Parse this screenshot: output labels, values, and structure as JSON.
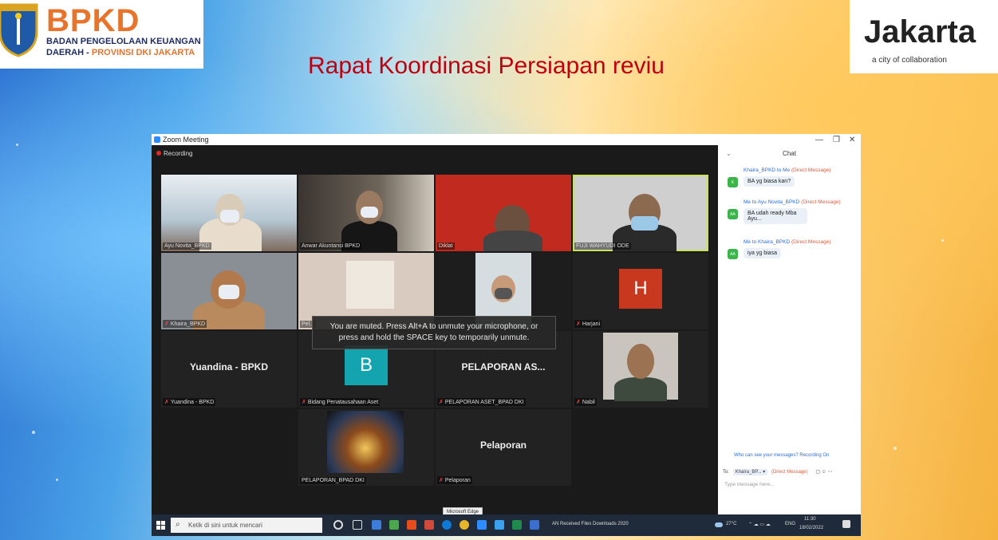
{
  "bpkd": {
    "emblem_text": "JAYA RAYA",
    "word": "BPKD",
    "line1": "BADAN PENGELOLAAN KEUANGAN",
    "line2_a": "DAERAH",
    "line2_dash": "-",
    "line2_b": "PROVINSI DKI JAKARTA"
  },
  "jakarta": {
    "word": "Jakarta",
    "tagline": "a city of collaboration"
  },
  "title": "Rapat Koordinasi Persiapan reviu",
  "zoom": {
    "window_title": "Zoom Meeting",
    "recording": "Recording",
    "toast_line1": "You are muted. Press Alt+A to unmute your microphone, or",
    "toast_line2": "press and hold the SPACE key to temporarily unmute.",
    "tiles": [
      {
        "label": "Ayu Novita_BPKD"
      },
      {
        "label": "Anwar Akuntansi BPKD"
      },
      {
        "label": "Diklat"
      },
      {
        "label": "FUJI WAHYUDI ODE"
      },
      {
        "label": "Khaira_BPKD"
      },
      {
        "label": "Pel..."
      },
      {
        "label": ""
      },
      {
        "label": "Harjani",
        "initial": "H"
      },
      {
        "label": "Yuandina - BPKD",
        "bigname": "Yuandina - BPKD"
      },
      {
        "label": "Bidang Penatausahaan Aset",
        "initial": "B"
      },
      {
        "label": "PELAPORAN ASET_BPAD DKI",
        "bigname": "PELAPORAN AS..."
      },
      {
        "label": "Nabil"
      },
      {
        "label": "PELAPORAN_BPAD DKI"
      },
      {
        "label": "Pelaporan",
        "bigname": "Pelaporan"
      }
    ]
  },
  "chat": {
    "header": "Chat",
    "messages": [
      {
        "meta_from": "Khaira_BPKD to Me",
        "meta_dm": "(Direct Message)",
        "avatar": "K",
        "text": "BA yg biasa kan?"
      },
      {
        "meta_from": "Me to Ayu Novita_BPKD",
        "meta_dm": "(Direct Message)",
        "avatar": "AA",
        "text": "BA udah ready Mba Ayu..."
      },
      {
        "meta_from": "Me to Khaira_BPKD",
        "meta_dm": "(Direct Message)",
        "avatar": "AA",
        "text": "iya yg biasa"
      }
    ],
    "notice": "Who can see your messages? Recording On",
    "to_label": "To:",
    "to_value": "Khaira_BP... ▾",
    "to_dm": "(Direct Message)",
    "input_placeholder": "Type message here..."
  },
  "taskbar": {
    "search_placeholder": "Ketik di sini untuk mencari",
    "edge_tooltip": "Microsoft Edge",
    "folders": "AN  Received Files  Downloads  2020",
    "weather": "27°C",
    "lang": "ENG",
    "time": "11:30",
    "date": "18/02/2022"
  },
  "colors": {
    "accent_orange": "#e8732b",
    "title_red": "#c0000f",
    "zoom_blue": "#2d8cff"
  }
}
